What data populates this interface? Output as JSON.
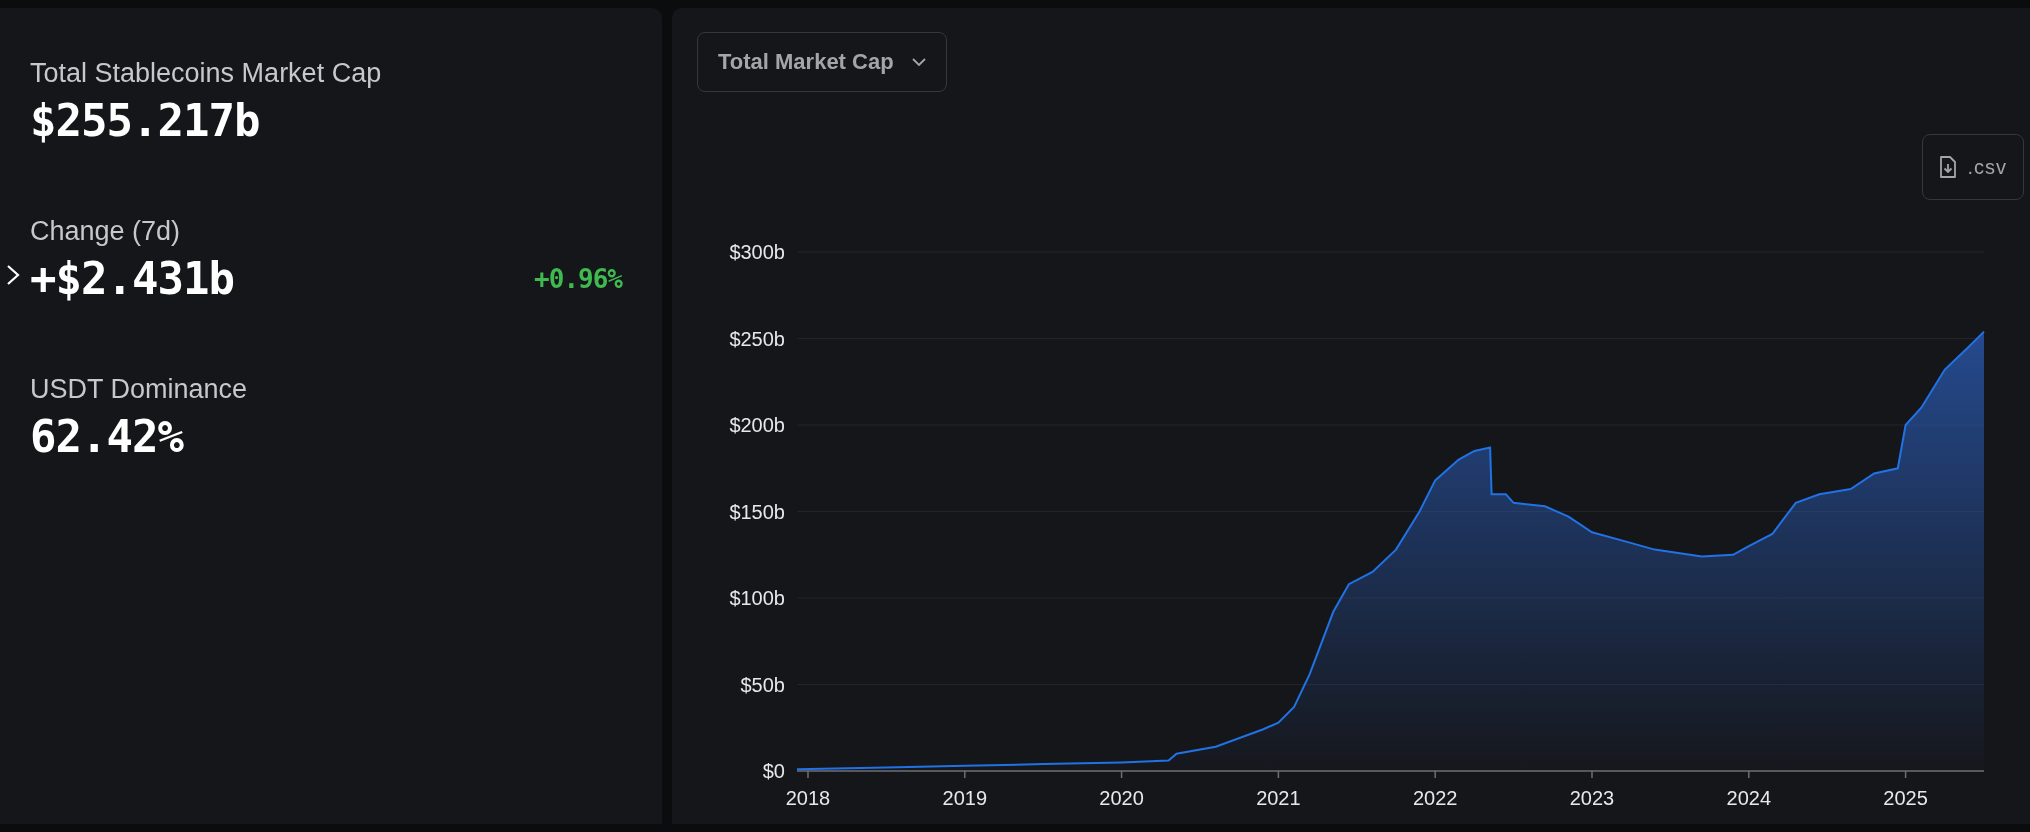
{
  "stats": [
    {
      "label": "Total Stablecoins Market Cap",
      "value": "$255.217b"
    },
    {
      "label": "Change (7d)",
      "value": "+$2.431b",
      "change": "+0.96%",
      "expandable": true
    },
    {
      "label": "USDT Dominance",
      "value": "62.42%"
    }
  ],
  "chart_panel": {
    "dropdown": {
      "label": "Total Market Cap"
    },
    "csv_button": {
      "label": ".csv"
    },
    "chart_data": {
      "type": "area",
      "x": [
        2017.93,
        2018.5,
        2019.0,
        2019.5,
        2020.0,
        2020.3,
        2020.35,
        2020.6,
        2020.9,
        2021.0,
        2021.1,
        2021.2,
        2021.35,
        2021.45,
        2021.6,
        2021.75,
        2021.9,
        2022.0,
        2022.15,
        2022.25,
        2022.35,
        2022.36,
        2022.45,
        2022.5,
        2022.7,
        2022.85,
        2023.0,
        2023.2,
        2023.4,
        2023.55,
        2023.7,
        2023.9,
        2024.0,
        2024.15,
        2024.3,
        2024.45,
        2024.65,
        2024.8,
        2024.95,
        2025.0,
        2025.1,
        2025.25,
        2025.4,
        2025.5
      ],
      "grid": true,
      "series": [
        {
          "color": "#2172e5",
          "values": [
            1,
            2,
            3,
            4,
            5,
            6,
            10,
            14,
            24,
            28,
            37,
            56,
            92,
            108,
            115,
            128,
            150,
            168,
            180,
            185,
            187,
            160,
            160,
            155,
            153,
            147,
            138,
            133,
            128,
            126,
            124,
            125,
            130,
            137,
            155,
            160,
            163,
            172,
            175,
            200,
            210,
            232,
            245,
            254
          ]
        }
      ],
      "xlim": [
        2017.93,
        2025.5
      ],
      "ylim": [
        0,
        300
      ],
      "xticks": [
        2018,
        2019,
        2020,
        2021,
        2022,
        2023,
        2024,
        2025
      ],
      "yticks": [
        {
          "value": 0,
          "label": "$0"
        },
        {
          "value": 50,
          "label": "$50b"
        },
        {
          "value": 100,
          "label": "$100b"
        },
        {
          "value": 150,
          "label": "$150b"
        },
        {
          "value": 200,
          "label": "$200b"
        },
        {
          "value": 250,
          "label": "$250b"
        },
        {
          "value": 300,
          "label": "$300b"
        }
      ]
    }
  }
}
